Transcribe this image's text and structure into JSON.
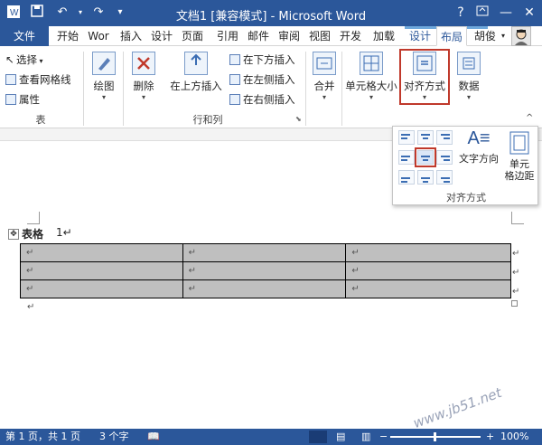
{
  "title_bar": {
    "title": "文档1 [兼容模式] - Microsoft Word",
    "help": "?",
    "minimize": "—",
    "restore": "□",
    "close": "✕",
    "icons": [
      "save-icon",
      "undo-icon",
      "redo-icon",
      "customize-qat-icon"
    ]
  },
  "tabs": [
    "文件",
    "开始",
    "Wor",
    "插入",
    "设计",
    "页面",
    "引用",
    "邮件",
    "审阅",
    "视图",
    "开发",
    "加载",
    "设计",
    "布局"
  ],
  "active_tab": "布局",
  "user": "胡俊",
  "ribbon": {
    "table_group": {
      "select": "选择",
      "gridlines": "查看网格线",
      "properties": "属性",
      "label": "表"
    },
    "draw": "绘图",
    "delete": "删除",
    "insert_above": "在上方插入",
    "insert_below": "在下方插入",
    "insert_left": "在左侧插入",
    "insert_right": "在右侧插入",
    "rows_cols_label": "行和列",
    "merge": "合并",
    "cell_size": "单元格大小",
    "alignment": "对齐方式",
    "data": "数据"
  },
  "dropdown": {
    "text_direction": "文字方向",
    "cell_margins_1": "单元",
    "cell_margins_2": "格边距",
    "label": "对齐方式"
  },
  "document": {
    "caption_label": "表格",
    "caption_num": "1↵",
    "mark": "↵",
    "rows": 3,
    "cols": 3
  },
  "status": {
    "page": "第 1 页，共 1 页",
    "words": "3 个字",
    "zoom": "100%",
    "watermark": "www.jb51.net"
  },
  "colors": {
    "accent": "#2b579a",
    "highlight": "#c0392b",
    "cell_fill": "#bfbfbf"
  }
}
